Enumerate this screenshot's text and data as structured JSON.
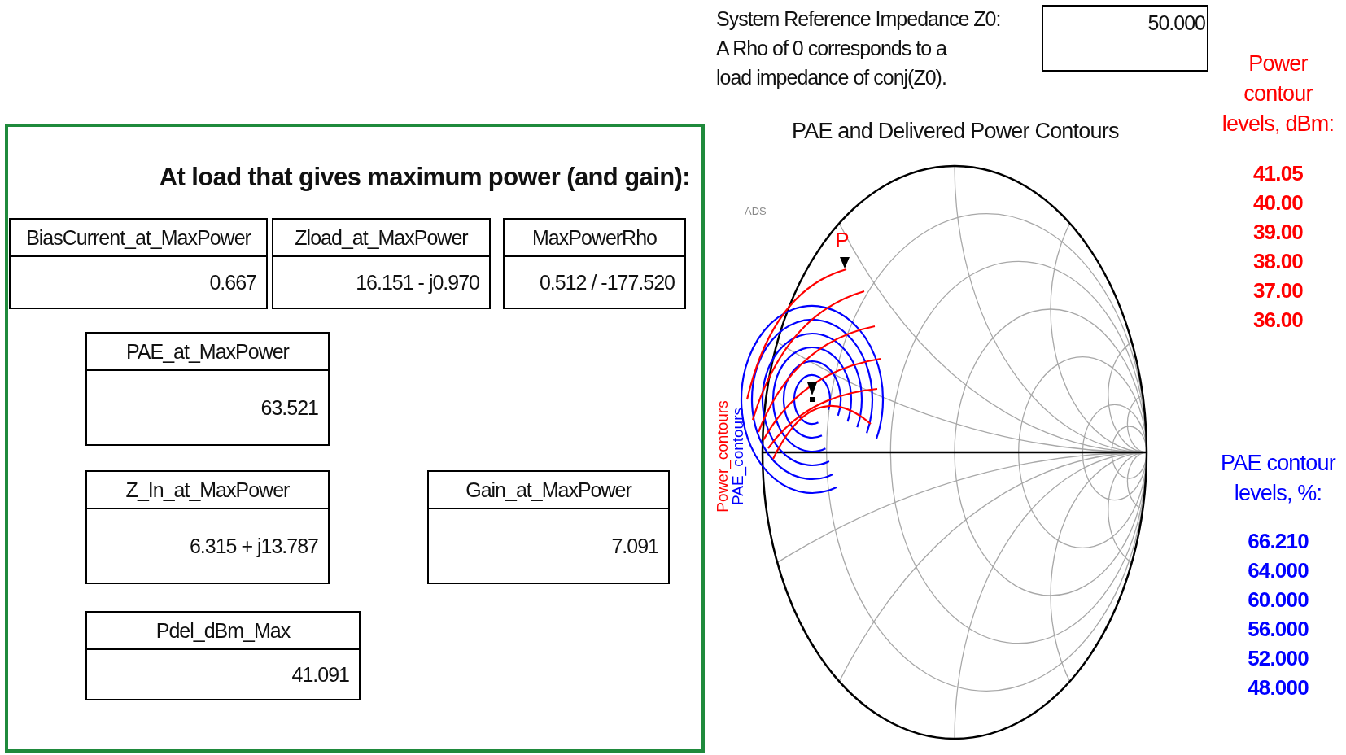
{
  "reference": {
    "label": "System Reference Impedance Z0:",
    "note_lines": [
      "A Rho of 0 corresponds to a",
      "load impedance of conj(Z0)."
    ],
    "value": "50.000"
  },
  "panel": {
    "title": "At load that gives maximum power (and gain):",
    "cards": [
      {
        "label": "BiasCurrent_at_MaxPower",
        "value": "0.667"
      },
      {
        "label": "Zload_at_MaxPower",
        "value": "16.151 - j0.970"
      },
      {
        "label": "MaxPowerRho",
        "value": "0.512 / -177.520"
      },
      {
        "label": "PAE_at_MaxPower",
        "value": "63.521"
      },
      {
        "label": "Z_In_at_MaxPower",
        "value": "6.315 + j13.787"
      },
      {
        "label": "Gain_at_MaxPower",
        "value": "7.091"
      },
      {
        "label": "Pdel_dBm_Max",
        "value": "41.091"
      }
    ]
  },
  "chart": {
    "title": "PAE and Delivered Power Contours",
    "watermark": "ADS",
    "marker": "P",
    "legend": [
      {
        "name": "Power_contours",
        "color": "#ff0000"
      },
      {
        "name": "PAE_contours",
        "color": "#0000ff"
      }
    ]
  },
  "power_levels": {
    "heading_lines": [
      "Power",
      "contour",
      "levels, dBm:"
    ],
    "values": [
      "41.05",
      "40.00",
      "39.00",
      "38.00",
      "37.00",
      "36.00"
    ]
  },
  "pae_levels": {
    "heading_lines": [
      "PAE contour",
      "levels, %:"
    ],
    "values": [
      "66.210",
      "64.000",
      "60.000",
      "56.000",
      "52.000",
      "48.000"
    ]
  }
}
